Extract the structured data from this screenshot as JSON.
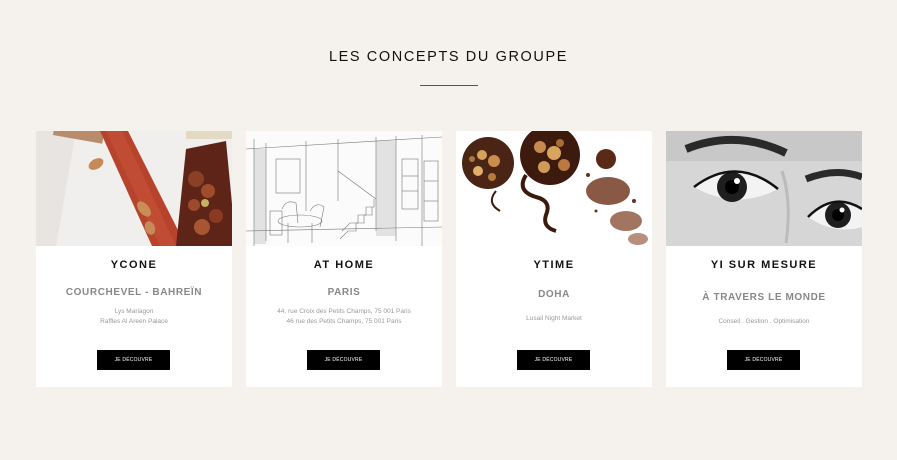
{
  "section": {
    "title": "LES CONCEPTS DU GROUPE"
  },
  "cards": [
    {
      "name": "YCONE",
      "location": "COURCHEVEL   -   BAHREÏN",
      "details": [
        "Lys Mariagon",
        "Raffles Al Areen Palace"
      ],
      "button": "JE DÉCOUVRE"
    },
    {
      "name": "AT HOME",
      "location": "PARIS",
      "details": [
        "44, rue Croix des Petits Champs, 75 001 Paris",
        "46 rue des Petits Champs, 75 001 Paris"
      ],
      "button": "JE DÉCOUVRE"
    },
    {
      "name": "YTIME",
      "location": "DOHA",
      "details": [
        "Lusail Night Market"
      ],
      "button": "JE DÉCOUVRE"
    },
    {
      "name": "YI SUR MESURE",
      "location": "À TRAVERS LE MONDE",
      "details": [
        "Conseil . Gestion . Optimisation"
      ],
      "button": "JE DÉCOUVRE"
    }
  ],
  "colors": {
    "background": "#f5f2ee",
    "card": "#ffffff",
    "button": "#000000"
  }
}
